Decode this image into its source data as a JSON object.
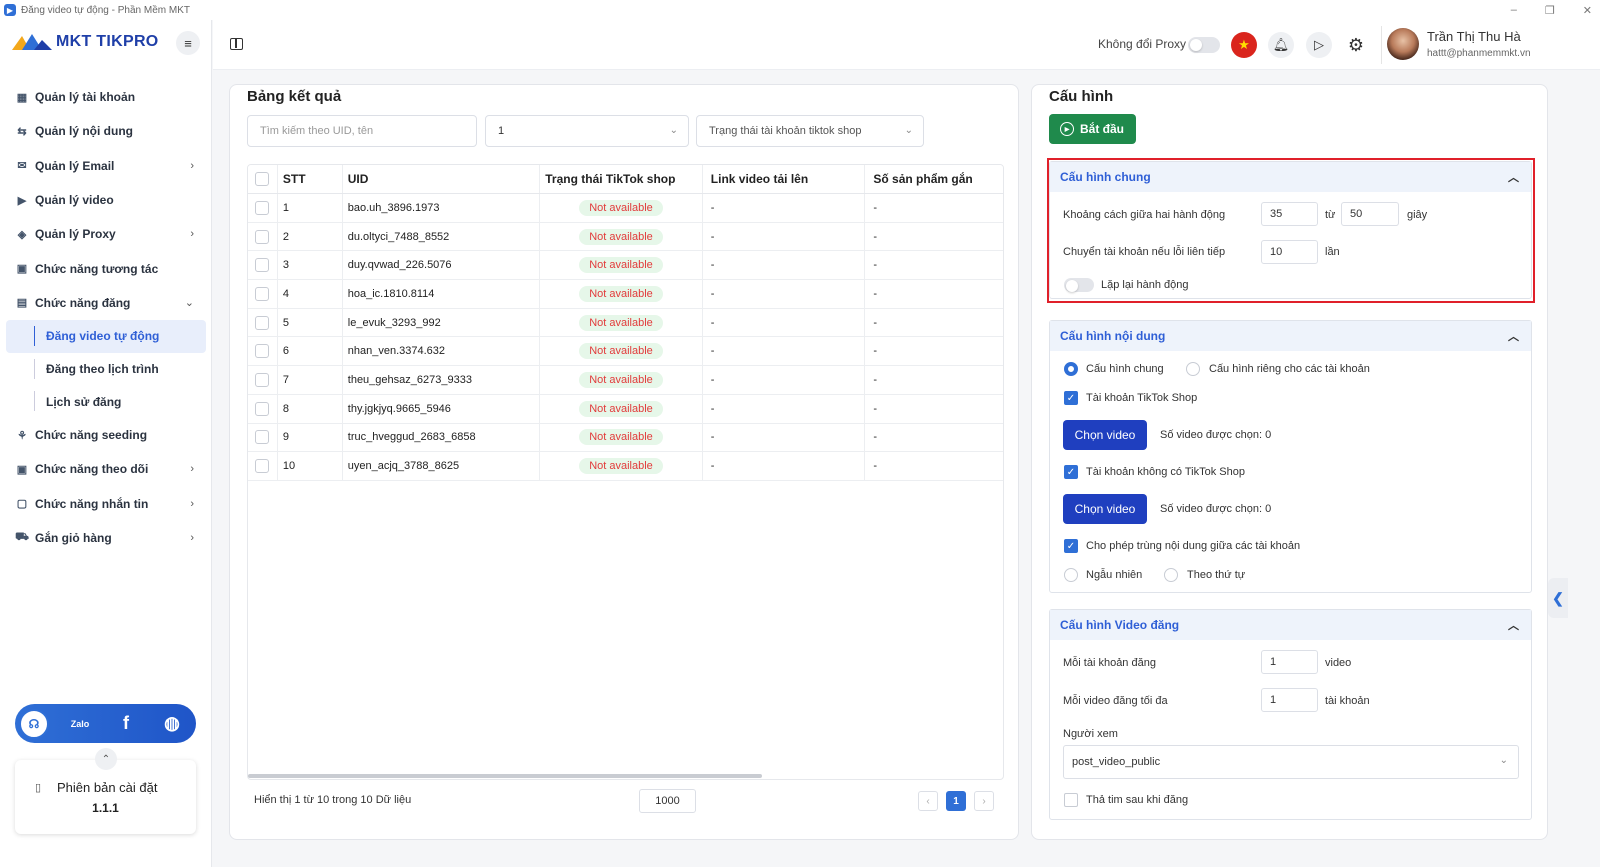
{
  "window": {
    "title": "Đăng video tự động - Phần Mềm MKT",
    "minimize": "–",
    "restore": "❐",
    "close": "✕"
  },
  "app": {
    "logo_text": "MKT TIKPRO"
  },
  "sidebar": {
    "items": [
      {
        "label": "Quản lý tài khoản",
        "icon": "▦",
        "chevron": ""
      },
      {
        "label": "Quản lý nội dung",
        "icon": "⇆",
        "chevron": ""
      },
      {
        "label": "Quản lý Email",
        "icon": "✉",
        "chevron": "›"
      },
      {
        "label": "Quản lý video",
        "icon": "▶",
        "chevron": ""
      },
      {
        "label": "Quản lý Proxy",
        "icon": "◈",
        "chevron": "›"
      },
      {
        "label": "Chức năng tương tác",
        "icon": "▣",
        "chevron": ""
      },
      {
        "label": "Chức năng đăng",
        "icon": "▤",
        "chevron": "⌄"
      }
    ],
    "subitems": [
      {
        "label": "Đăng video tự động"
      },
      {
        "label": "Đăng theo lịch trình"
      },
      {
        "label": "Lịch sử đăng"
      }
    ],
    "items2": [
      {
        "label": "Chức năng seeding",
        "icon": "⚘",
        "chevron": ""
      },
      {
        "label": "Chức năng theo dõi",
        "icon": "▣",
        "chevron": "›"
      },
      {
        "label": "Chức năng nhắn tin",
        "icon": "▢",
        "chevron": "›"
      },
      {
        "label": "Gắn giỏ hàng",
        "icon": "⛟",
        "chevron": "›"
      }
    ],
    "social": {
      "zalo": "Zalo",
      "facebook": "f",
      "web": "◍",
      "support": "☊"
    },
    "version_label": "Phiên bản cài đặt",
    "version_number": "1.1.1"
  },
  "topbar": {
    "proxy_label": "Không đổi Proxy",
    "user_name": "Trần Thị Thu Hà",
    "user_email": "hattt@phanmemmkt.vn"
  },
  "results": {
    "title": "Bảng kết quả",
    "search_placeholder": "Tìm kiếm theo UID, tên",
    "select_value": "1",
    "status_placeholder": "Trạng thái tài khoản tiktok shop",
    "columns": [
      "STT",
      "UID",
      "Trạng thái TikTok shop",
      "Link video tải lên",
      "Số sản phẩm gắn"
    ],
    "rows": [
      {
        "stt": "1",
        "uid": "bao.uh_3896.1973",
        "status": "Not available",
        "link": "-",
        "count": "-"
      },
      {
        "stt": "2",
        "uid": "du.oltyci_7488_8552",
        "status": "Not available",
        "link": "-",
        "count": "-"
      },
      {
        "stt": "3",
        "uid": "duy.qvwad_226.5076",
        "status": "Not available",
        "link": "-",
        "count": "-"
      },
      {
        "stt": "4",
        "uid": "hoa_ic.1810.8114",
        "status": "Not available",
        "link": "-",
        "count": "-"
      },
      {
        "stt": "5",
        "uid": "le_evuk_3293_992",
        "status": "Not available",
        "link": "-",
        "count": "-"
      },
      {
        "stt": "6",
        "uid": "nhan_ven.3374.632",
        "status": "Not available",
        "link": "-",
        "count": "-"
      },
      {
        "stt": "7",
        "uid": "theu_gehsaz_6273_9333",
        "status": "Not available",
        "link": "-",
        "count": "-"
      },
      {
        "stt": "8",
        "uid": "thy.jgkjyq.9665_5946",
        "status": "Not available",
        "link": "-",
        "count": "-"
      },
      {
        "stt": "9",
        "uid": "truc_hveggud_2683_6858",
        "status": "Not available",
        "link": "-",
        "count": "-"
      },
      {
        "stt": "10",
        "uid": "uyen_acjq_3788_8625",
        "status": "Not available",
        "link": "-",
        "count": "-"
      }
    ],
    "footer_info": "Hiển thị 1 từ 10 trong 10 Dữ liệu",
    "page_size": "1000",
    "current_page": "1",
    "prev": "‹",
    "next": "›"
  },
  "config": {
    "title": "Cấu hình",
    "start_label": "Bắt đầu",
    "general": {
      "title": "Cấu hình chung",
      "interval_label": "Khoảng cách giữa hai hành động",
      "interval_from": "35",
      "interval_to_label": "từ",
      "interval_to": "50",
      "interval_unit": "giây",
      "switch_label": "Chuyển tài khoản nếu lỗi liên tiếp",
      "switch_value": "10",
      "switch_unit": "lần",
      "repeat_label": "Lặp lại hành động"
    },
    "content": {
      "title": "Cấu hình nội dung",
      "radio_general": "Cấu hình chung",
      "radio_private": "Cấu hình riêng cho các tài khoản",
      "shop_label": "Tài khoản TikTok Shop",
      "choose_video": "Chọn video",
      "selected_count": "Số video được chọn: 0",
      "noshop_label": "Tài khoản không có TikTok Shop",
      "allow_dup": "Cho phép trùng nội dung giữa các tài khoản",
      "random": "Ngẫu nhiên",
      "sequential": "Theo thứ tự"
    },
    "video": {
      "title": "Cấu hình Video đăng",
      "per_account_label": "Mỗi tài khoản đăng",
      "per_account_value": "1",
      "per_account_unit": "video",
      "max_label": "Mỗi video đăng tối đa",
      "max_value": "1",
      "max_unit": "tài khoản",
      "viewer_label": "Người xem",
      "viewer_value": "post_video_public",
      "heart_label": "Thả tim sau khi đăng"
    }
  }
}
